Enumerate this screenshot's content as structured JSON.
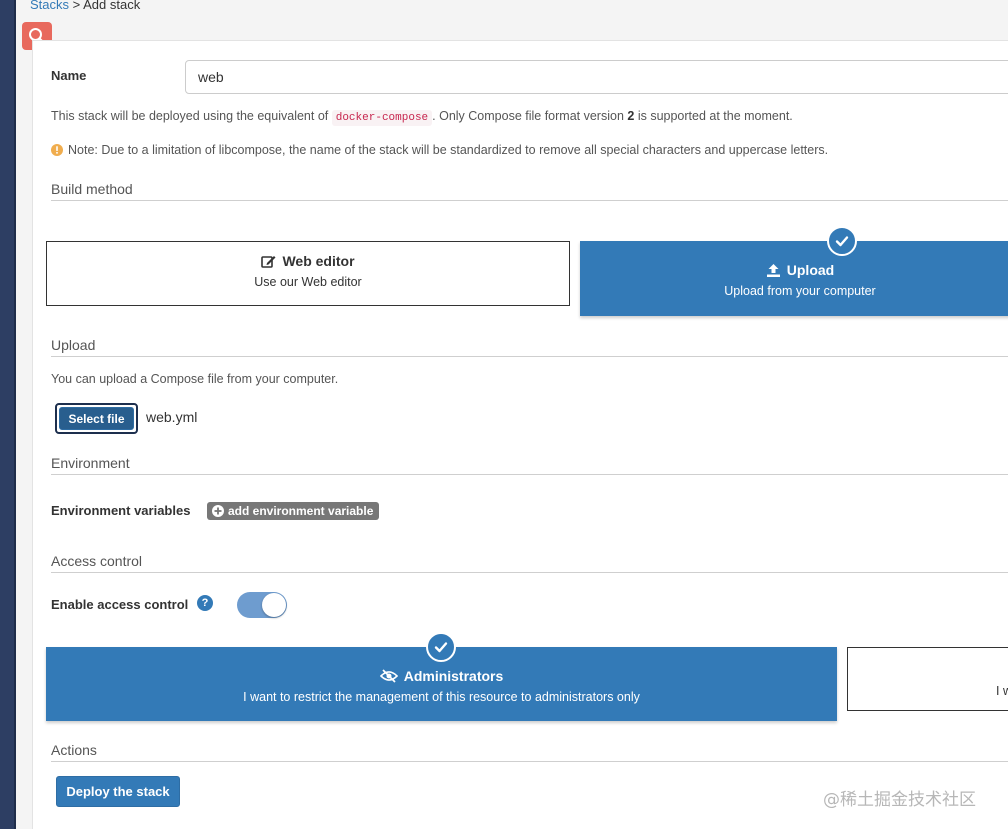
{
  "breadcrumb": {
    "link": "Stacks",
    "sep": " > ",
    "current": "Add stack"
  },
  "form": {
    "name_label": "Name",
    "name_value": "web",
    "info_prefix": "This stack will be deployed using the equivalent of",
    "info_code": "docker-compose",
    "info_mid": ". Only Compose file format version",
    "info_version": "2",
    "info_suffix": "is supported at the moment.",
    "note": "Note: Due to a limitation of libcompose, the name of the stack will be standardized to remove all special characters and uppercase letters."
  },
  "build_method": {
    "title": "Build method",
    "options": [
      {
        "title": "Web editor",
        "subtitle": "Use our Web editor",
        "icon": "edit-icon",
        "selected": false
      },
      {
        "title": "Upload",
        "subtitle": "Upload from your computer",
        "icon": "upload-icon",
        "selected": true
      }
    ]
  },
  "upload": {
    "title": "Upload",
    "desc": "You can upload a Compose file from your computer.",
    "select_button": "Select file",
    "file_name": "web.yml"
  },
  "environment": {
    "title": "Environment",
    "vars_label": "Environment variables",
    "add_button": "add environment variable"
  },
  "access_control": {
    "title": "Access control",
    "enable_label": "Enable access control",
    "enabled": true,
    "options": [
      {
        "title": "Administrators",
        "subtitle": "I want to restrict the management of this resource to administrators only",
        "selected": true
      },
      {
        "title": "",
        "subtitle": "I w",
        "selected": false
      }
    ]
  },
  "actions": {
    "title": "Actions",
    "deploy_button": "Deploy the stack"
  },
  "watermark": "@稀土掘金技术社区",
  "colors": {
    "primary": "#337ab7",
    "search": "#e8695d",
    "sidebar": "#2d3e63",
    "warning": "#f0ad4e"
  }
}
